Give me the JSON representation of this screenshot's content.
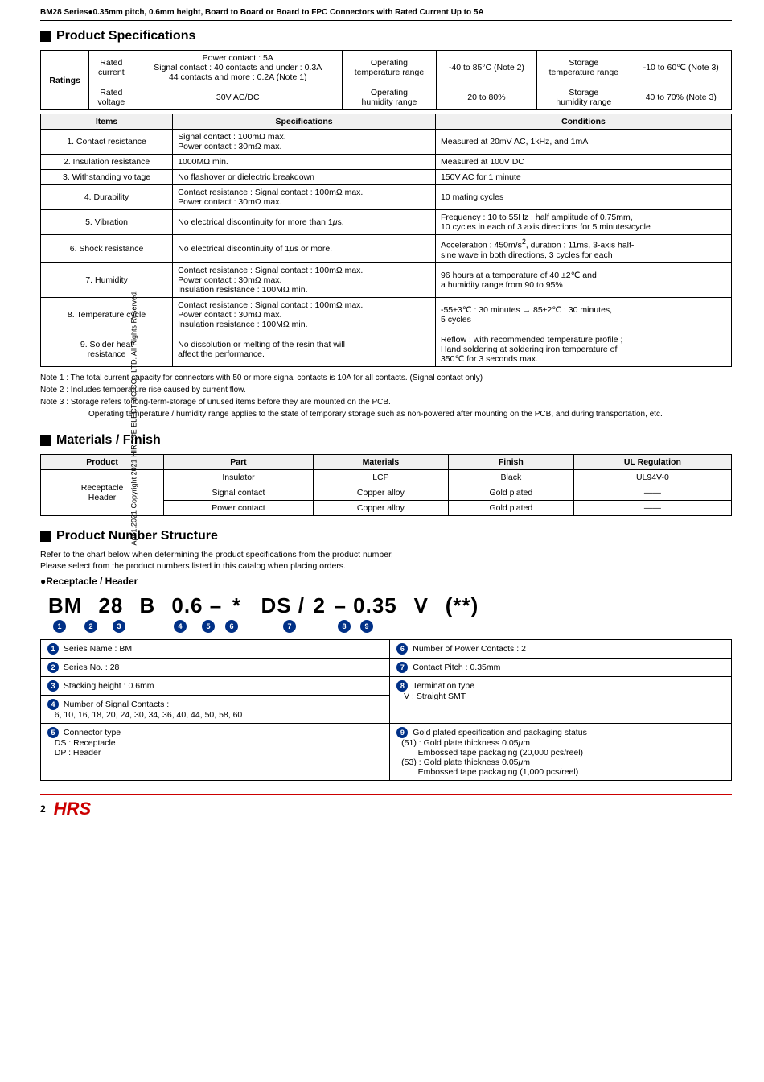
{
  "header": {
    "title": "BM28 Series●0.35mm pitch, 0.6mm height, Board to Board or Board to FPC Connectors with Rated Current Up to 5A"
  },
  "sidebar": {
    "text": "Apr.1.2021 Copyright 2021 HIROSE ELECTRIC CO., LTD. All Rights Reserved."
  },
  "product_specs": {
    "section_title": "Product Specifications",
    "ratings": {
      "headers": [
        "Ratings",
        "Rated current",
        "Power contact : 5A / Signal contact...",
        "Operating temperature range",
        "-40 to 85°C (Note 2)",
        "Storage temperature range",
        "-10 to 60°C (Note 3)"
      ],
      "row2": [
        "",
        "Rated voltage",
        "30V AC/DC",
        "Operating humidity range",
        "20 to 80%",
        "Storage humidity range",
        "40 to 70% (Note 3)"
      ]
    },
    "specs_table": {
      "headers": [
        "Items",
        "Specifications",
        "Conditions"
      ],
      "rows": [
        {
          "item": "1. Contact resistance",
          "spec": "Signal contact : 100mΩ max.\nPower contact : 30mΩ max.",
          "cond": "Measured at 20mV AC, 1kHz, and 1mA"
        },
        {
          "item": "2. Insulation resistance",
          "spec": "1000MΩ min.",
          "cond": "Measured at 100V DC"
        },
        {
          "item": "3. Withstanding voltage",
          "spec": "No flashover or dielectric breakdown",
          "cond": "150V AC for 1 minute"
        },
        {
          "item": "4. Durability",
          "spec": "Contact resistance : Signal contact : 100mΩ max.\nPower contact : 30mΩ max.",
          "cond": "10 mating cycles"
        },
        {
          "item": "5. Vibration",
          "spec": "No electrical discontinuity for more than 1μs.",
          "cond": "Frequency : 10 to 55Hz ; half amplitude of 0.75mm,\n10 cycles in each of 3 axis directions for 5 minutes/cycle"
        },
        {
          "item": "6. Shock resistance",
          "spec": "No electrical discontinuity of 1μs or more.",
          "cond": "Acceleration : 450m/s², duration : 11ms, 3-axis half-sine wave in both directions, 3 cycles for each"
        },
        {
          "item": "7. Humidity",
          "spec": "Contact resistance : Signal contact : 100mΩ max.\nPower contact : 30mΩ max.\nInsulation resistance : 100MΩ min.",
          "cond": "96 hours at a temperature of 40 ±2℃ and\na humidity range from 90 to 95%"
        },
        {
          "item": "8. Temperature cycle",
          "spec": "Contact resistance : Signal contact : 100mΩ max.\nPower contact : 30mΩ max.\nInsulation resistance : 100MΩ min.",
          "cond": "-55±3℃ : 30 minutes → 85±2℃ : 30 minutes,\n5 cycles"
        },
        {
          "item": "9. Solder heat\nresistance",
          "spec": "No dissolution or melting of the resin that will\naffect the performance.",
          "cond": "Reflow : with recommended temperature profile ;\nHand soldering at soldering iron temperature of\n350℃ for 3 seconds max."
        }
      ]
    },
    "notes": [
      "Note 1 : The total current capacity for connectors with 50 or more signal contacts is 10A for all contacts. (Signal contact only)",
      "Note 2 : Includes temperature rise caused by current flow.",
      "Note 3 : Storage refers to long-term-storage of unused items before they are mounted on the PCB.",
      "          Operating temperature / humidity range applies to the state of temporary storage such as non-powered after mounting on the",
      "          PCB, and during transportation, etc."
    ]
  },
  "materials_finish": {
    "section_title": "Materials / Finish",
    "table": {
      "headers": [
        "Product",
        "Part",
        "Materials",
        "Finish",
        "UL Regulation"
      ],
      "rows": [
        [
          "Receptacle\nHeader",
          "Insulator",
          "LCP",
          "Black",
          "UL94V-0"
        ],
        [
          "",
          "Signal contact",
          "Copper alloy",
          "Gold plated",
          "——"
        ],
        [
          "",
          "Power contact",
          "Copper alloy",
          "Gold plated",
          "——"
        ]
      ]
    }
  },
  "product_number": {
    "section_title": "Product Number Structure",
    "intro1": "Refer to the chart below when determining the product specifications from the product number.",
    "intro2": "Please select from the product numbers listed in this catalog when placing orders.",
    "sub_title": "●Receptacle / Header",
    "pn_display": "BM 28 B 0.6 – * DS / 2 – 0.35 V (**)",
    "pn_chars": [
      "BM",
      "28",
      "B",
      "0.6",
      "–",
      "*",
      "DS",
      "/",
      "2",
      "–",
      "0.35",
      "V",
      "(**)"
    ],
    "pn_indices": [
      "❶",
      "❷",
      "❸",
      "",
      "❹",
      "❺",
      "❻",
      "",
      "❼",
      "",
      "❽",
      "❾",
      ""
    ],
    "descriptions_left": [
      {
        "num": "❶",
        "text": "Series Name : BM"
      },
      {
        "num": "❷",
        "text": "Series No. : 28"
      },
      {
        "num": "❸",
        "text": "Stacking height : 0.6mm"
      },
      {
        "num": "❹",
        "text": "Number of Signal Contacts :\n6, 10, 16, 18, 20, 24, 30, 34, 36, 40, 44, 50, 58, 60"
      },
      {
        "num": "❺",
        "text": "Connector type\nDS : Receptacle\nDP : Header"
      }
    ],
    "descriptions_right": [
      {
        "num": "❻",
        "text": "Number of Power Contacts : 2"
      },
      {
        "num": "❼",
        "text": "Contact Pitch : 0.35mm"
      },
      {
        "num": "❽",
        "text": "Termination type\nV : Straight SMT"
      },
      {
        "num": "❾",
        "text": "Gold plated specification and packaging status\n(51) : Gold plate thickness 0.05μm\n       Embossed tape packaging (20,000 pcs/reel)\n(53) : Gold plate thickness 0.05μm\n       Embossed tape packaging (1,000 pcs/reel)"
      }
    ]
  },
  "footer": {
    "page_num": "2",
    "logo": "HRS"
  }
}
